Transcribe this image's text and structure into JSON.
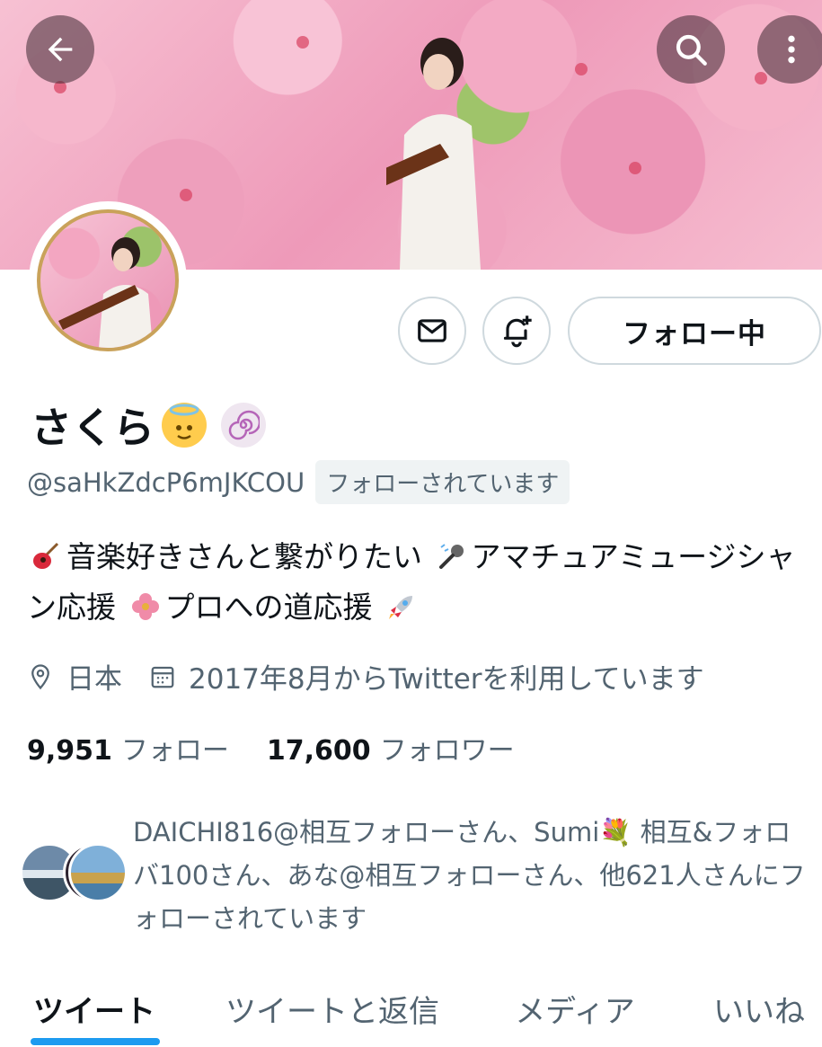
{
  "header": {
    "back_icon": "arrow-left-icon",
    "search_icon": "search-icon",
    "more_icon": "more-vertical-icon"
  },
  "profile": {
    "name": "さくら",
    "handle": "@saHkZdcP6mJKCOU",
    "follows_you": "フォローされています",
    "bio_part1": "音楽好きさんと繋がりたい",
    "bio_part2": "アマチュアミュージシャン応援",
    "bio_part3": "プロへの道応援",
    "location": "日本",
    "joined": "2017年8月からTwitterを利用しています",
    "following_count": "9,951",
    "following_label": "フォロー",
    "followers_count": "17,600",
    "followers_label": "フォロワー",
    "followed_by": "DAICHI816@相互フォローさん、Sumi💐 相互&フォロバ100さん、あな@相互フォローさん、他621人さんにフォローされています"
  },
  "actions": {
    "message_icon": "envelope-icon",
    "notify_icon": "bell-plus-icon",
    "follow_label": "フォロー中"
  },
  "tabs": [
    {
      "label": "ツイート",
      "active": true
    },
    {
      "label": "ツイートと返信",
      "active": false
    },
    {
      "label": "メディア",
      "active": false
    },
    {
      "label": "いいね",
      "active": false
    }
  ],
  "colors": {
    "accent": "#1d9bf0",
    "text": "#0f1419",
    "secondary": "#536471"
  }
}
